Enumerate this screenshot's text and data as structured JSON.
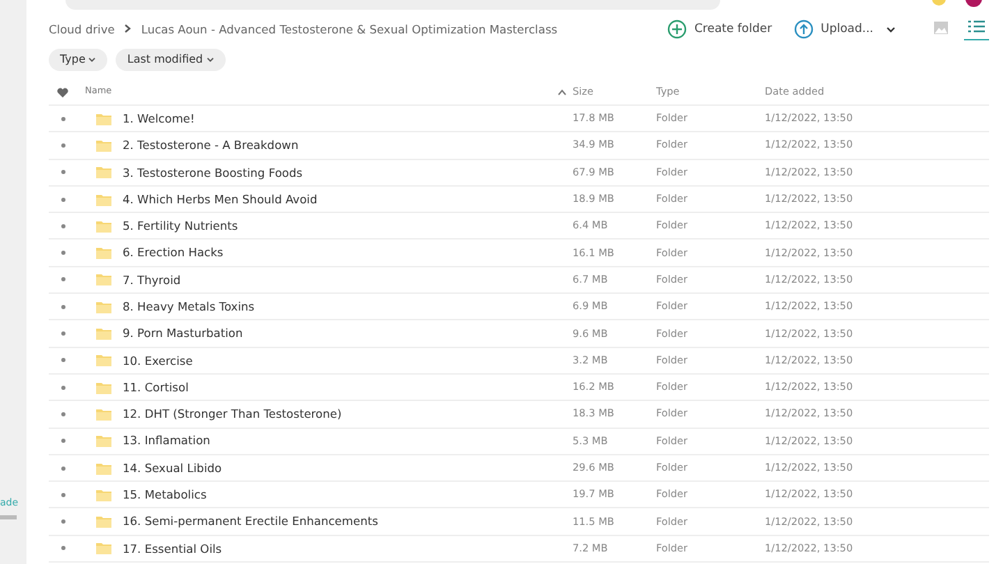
{
  "sidebar": {
    "link": "ade"
  },
  "breadcrumb": [
    "Cloud drive",
    "Lucas Aoun - Advanced Testosterone & Sexual Optimization Masterclass"
  ],
  "actions": [
    {
      "label": "Create folder",
      "kind": "create"
    },
    {
      "label": "Upload...",
      "kind": "upload"
    }
  ],
  "views": [
    {
      "kind": "grid",
      "selected": false
    },
    {
      "kind": "list",
      "selected": true
    }
  ],
  "filters": [
    "Type",
    "Last modified"
  ],
  "table": {
    "columns": [
      "Name",
      "Size",
      "Type",
      "Date added"
    ],
    "rows": [
      {
        "name": "1. Welcome!",
        "size": "17.8 MB",
        "type": "Folder",
        "date": "1/12/2022, 13:50"
      },
      {
        "name": "2. Testosterone - A Breakdown",
        "size": "34.9 MB",
        "type": "Folder",
        "date": "1/12/2022, 13:50"
      },
      {
        "name": "3. Testosterone Boosting Foods",
        "size": "67.9 MB",
        "type": "Folder",
        "date": "1/12/2022, 13:50"
      },
      {
        "name": "4. Which Herbs Men Should Avoid",
        "size": "18.9 MB",
        "type": "Folder",
        "date": "1/12/2022, 13:50"
      },
      {
        "name": "5. Fertility Nutrients",
        "size": "6.4 MB",
        "type": "Folder",
        "date": "1/12/2022, 13:50"
      },
      {
        "name": "6. Erection Hacks",
        "size": "16.1 MB",
        "type": "Folder",
        "date": "1/12/2022, 13:50"
      },
      {
        "name": "7. Thyroid",
        "size": "6.7 MB",
        "type": "Folder",
        "date": "1/12/2022, 13:50"
      },
      {
        "name": "8. Heavy Metals Toxins",
        "size": "6.9 MB",
        "type": "Folder",
        "date": "1/12/2022, 13:50"
      },
      {
        "name": "9. Porn Masturbation",
        "size": "9.6 MB",
        "type": "Folder",
        "date": "1/12/2022, 13:50"
      },
      {
        "name": "10. Exercise",
        "size": "3.2 MB",
        "type": "Folder",
        "date": "1/12/2022, 13:50"
      },
      {
        "name": "11. Cortisol",
        "size": "16.2 MB",
        "type": "Folder",
        "date": "1/12/2022, 13:50"
      },
      {
        "name": "12. DHT (Stronger Than Testosterone)",
        "size": "18.3 MB",
        "type": "Folder",
        "date": "1/12/2022, 13:50"
      },
      {
        "name": "13. Inflamation",
        "size": "5.3 MB",
        "type": "Folder",
        "date": "1/12/2022, 13:50"
      },
      {
        "name": "14. Sexual Libido",
        "size": "29.6 MB",
        "type": "Folder",
        "date": "1/12/2022, 13:50"
      },
      {
        "name": "15. Metabolics",
        "size": "19.7 MB",
        "type": "Folder",
        "date": "1/12/2022, 13:50"
      },
      {
        "name": "16. Semi-permanent Erectile Enhancements",
        "size": "11.5 MB",
        "type": "Folder",
        "date": "1/12/2022, 13:50"
      },
      {
        "name": "17. Essential Oils",
        "size": "7.2 MB",
        "type": "Folder",
        "date": "1/12/2022, 13:50"
      }
    ]
  }
}
